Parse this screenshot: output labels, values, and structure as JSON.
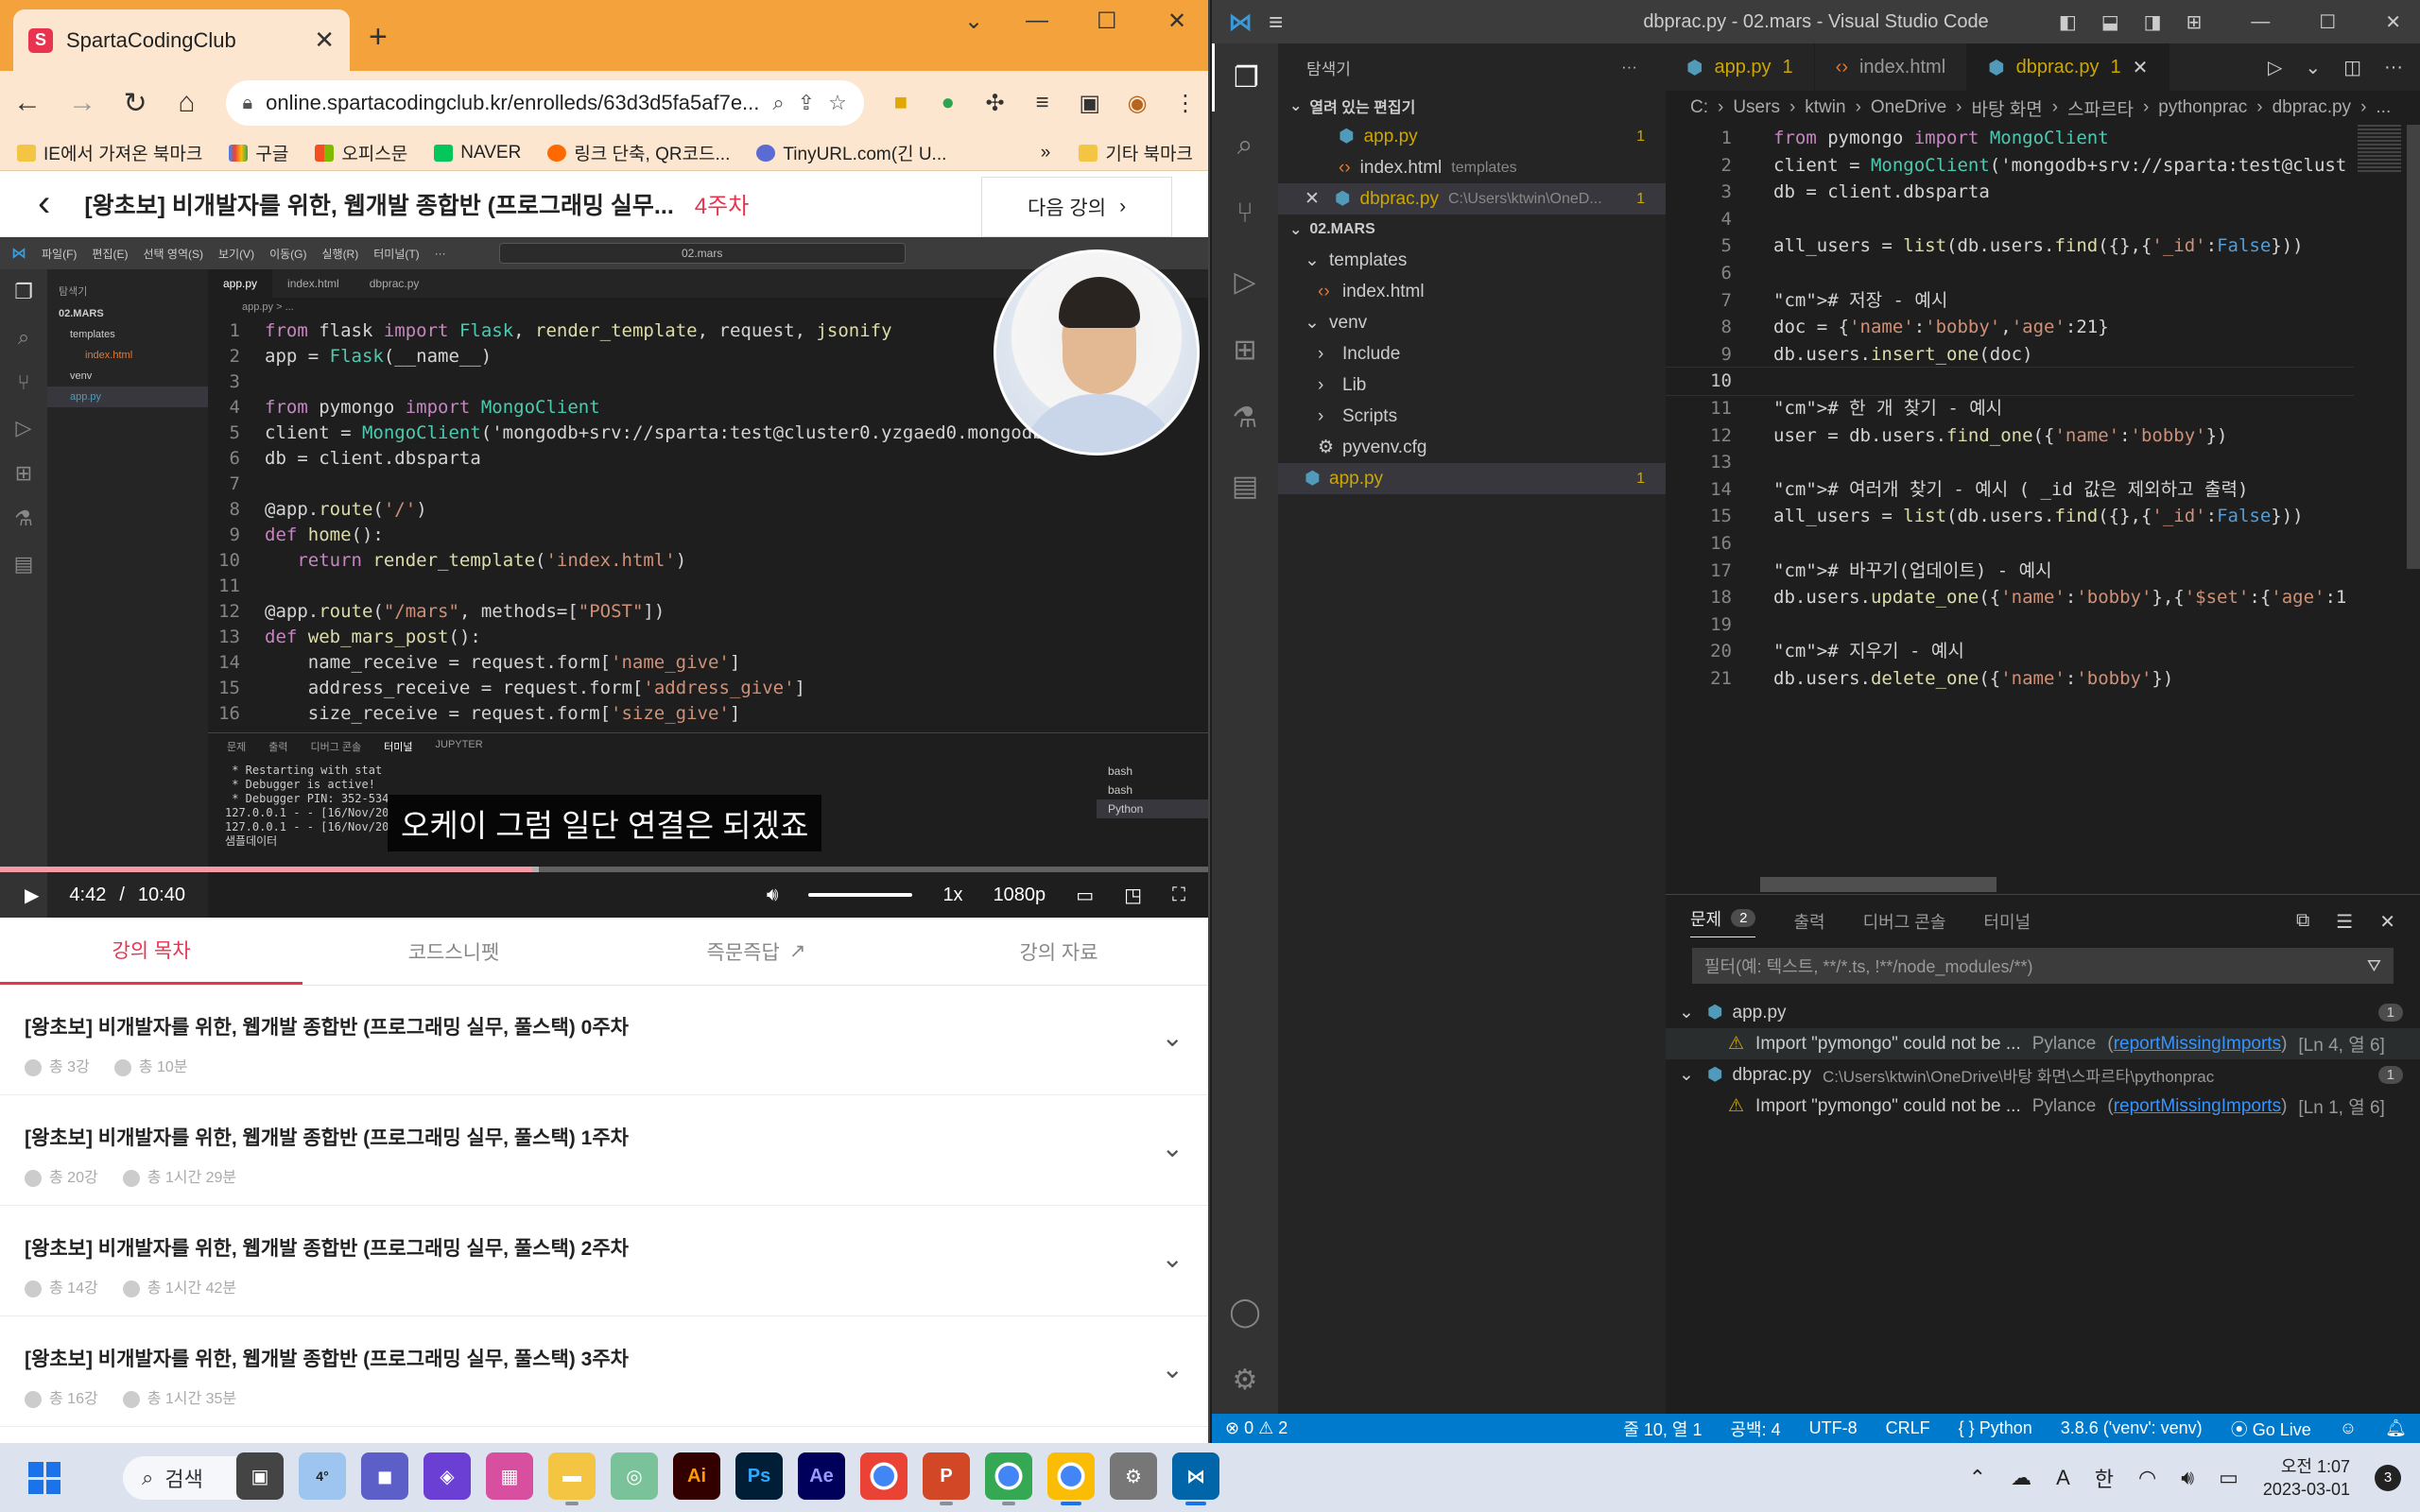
{
  "chrome": {
    "tab_title": "SpartaCodingClub",
    "tab_favicon": "S",
    "new_tab": "+",
    "window_controls": [
      "—",
      "☐",
      "✕"
    ],
    "url": "online.spartacodingclub.kr/enrolleds/63d3d5fa5af7e...",
    "bookmarks": [
      "IE에서 가져온 북마크",
      "구글",
      "오피스문",
      "NAVER",
      "링크 단축, QR코드...",
      "TinyURL.com(긴 U..."
    ],
    "bookmarks_more": "»",
    "bookmarks_other": "기타 북마크"
  },
  "page": {
    "title": "[왕초보] 비개발자를 위한, 웹개발 종합반 (프로그래밍 실무...",
    "week": "4주차",
    "next_label": "다음 강의"
  },
  "video": {
    "subtitle": "오케이 그럼 일단 연결은 되겠죠",
    "current_time": "4:42",
    "separator": "/",
    "duration": "10:40",
    "progress_fraction": 0.44,
    "speed": "1x",
    "quality": "1080p",
    "inner_vscode": {
      "search": "02.mars",
      "explorer_title": "탐색기",
      "tree": [
        "02.MARS",
        "templates",
        "index.html",
        "venv",
        "app.py"
      ],
      "tabs": [
        "app.py",
        "index.html",
        "dbprac.py"
      ],
      "breadcrumb": "app.py > ...",
      "code": [
        "from flask import Flask, render_template, request, jsonify",
        "app = Flask(__name__)",
        "",
        "from pymongo import MongoClient",
        "client = MongoClient('mongodb+srv://sparta:test@cluster0.yzgaed0.mongodb.",
        "db = client.dbsparta",
        "",
        "@app.route('/')",
        "def home():",
        "   return render_template('index.html')",
        "",
        "@app.route(\"/mars\", methods=[\"POST\"])",
        "def web_mars_post():",
        "    name_receive = request.form['name_give']",
        "    address_receive = request.form['address_give']",
        "    size_receive = request.form['size_give']"
      ],
      "terminal_tabs": [
        "문제",
        "출력",
        "디버그 콘솔",
        "터미널",
        "JUPYTER"
      ],
      "terminal_lines": " * Restarting with stat\n * Debugger is active!\n * Debugger PIN: 352-534\n127.0.0.1 - - [16/Nov/20\n127.0.0.1 - - [16/Nov/20\n샘플데이터",
      "terminal_sessions": [
        "bash",
        "bash",
        "Python"
      ]
    }
  },
  "lecture_tabs": [
    {
      "label": "강의 목차",
      "active": true
    },
    {
      "label": "코드스니펫",
      "active": false
    },
    {
      "label": "즉문즉답",
      "active": false
    },
    {
      "label": "강의 자료",
      "active": false
    }
  ],
  "weeks": [
    {
      "title": "[왕초보] 비개발자를 위한, 웹개발 종합반 (프로그래밍 실무, 풀스택) 0주차",
      "lectures": "총 3강",
      "time": "총 10분"
    },
    {
      "title": "[왕초보] 비개발자를 위한, 웹개발 종합반 (프로그래밍 실무, 풀스택) 1주차",
      "lectures": "총 20강",
      "time": "총 1시간 29분"
    },
    {
      "title": "[왕초보] 비개발자를 위한, 웹개발 종합반 (프로그래밍 실무, 풀스택) 2주차",
      "lectures": "총 14강",
      "time": "총 1시간 42분"
    },
    {
      "title": "[왕초보] 비개발자를 위한, 웹개발 종합반 (프로그래밍 실무, 풀스택) 3주차",
      "lectures": "총 16강",
      "time": "총 1시간 35분"
    }
  ],
  "vscode": {
    "window_title": "dbprac.py - 02.mars - Visual Studio Code",
    "explorer_title": "탐색기",
    "explorer_more": "···",
    "open_editors_label": "열려 있는 편집기",
    "open_editors": [
      {
        "name": "app.py",
        "extra": "",
        "count": "1"
      },
      {
        "name": "index.html",
        "extra": "templates",
        "count": ""
      },
      {
        "name": "dbprac.py",
        "extra": "C:\\Users\\ktwin\\OneD...",
        "count": "1"
      }
    ],
    "folder_label": "02.MARS",
    "tree": [
      {
        "name": "templates",
        "depth": 1,
        "kind": "folder"
      },
      {
        "name": "index.html",
        "depth": 2,
        "kind": "html"
      },
      {
        "name": "venv",
        "depth": 1,
        "kind": "folder"
      },
      {
        "name": "Include",
        "depth": 2,
        "kind": "folder"
      },
      {
        "name": "Lib",
        "depth": 2,
        "kind": "folder"
      },
      {
        "name": "Scripts",
        "depth": 2,
        "kind": "folder"
      },
      {
        "name": "pyvenv.cfg",
        "depth": 2,
        "kind": "cfg"
      },
      {
        "name": "app.py",
        "depth": 1,
        "kind": "py",
        "count": "1"
      }
    ],
    "tabs": [
      {
        "name": "app.py",
        "badge": "1"
      },
      {
        "name": "index.html",
        "badge": ""
      },
      {
        "name": "dbprac.py",
        "badge": "1"
      }
    ],
    "breadcrumb": [
      "C:",
      "Users",
      "ktwin",
      "OneDrive",
      "바탕 화면",
      "스파르타",
      "pythonprac",
      "dbprac.py",
      "..."
    ],
    "code": [
      "from pymongo import MongoClient",
      "client = MongoClient('mongodb+srv://sparta:test@clust",
      "db = client.dbsparta",
      "",
      "all_users = list(db.users.find({},{'_id':False}))",
      "",
      "# 저장 - 예시",
      "doc = {'name':'bobby','age':21}",
      "db.users.insert_one(doc)",
      "",
      "# 한 개 찾기 - 예시",
      "user = db.users.find_one({'name':'bobby'})",
      "",
      "# 여러개 찾기 - 예시 ( _id 값은 제외하고 출력)",
      "all_users = list(db.users.find({},{'_id':False}))",
      "",
      "# 바꾸기(업데이트) - 예시",
      "db.users.update_one({'name':'bobby'},{'$set':{'age':1",
      "",
      "# 지우기 - 예시",
      "db.users.delete_one({'name':'bobby'})"
    ],
    "current_line": 10,
    "panel_tabs": [
      "문제",
      "출력",
      "디버그 콘솔",
      "터미널"
    ],
    "problems_count": "2",
    "filter_placeholder": "필터(예: 텍스트, **/*.ts, !**/node_modules/**)",
    "problems": [
      {
        "file": "app.py",
        "path": "",
        "count": "1",
        "message": "Import \"pymongo\" could not be ...",
        "source": "Pylance",
        "rule": "reportMissingImports",
        "loc": "[Ln 4, 열 6]"
      },
      {
        "file": "dbprac.py",
        "path": "C:\\Users\\ktwin\\OneDrive\\바탕 화면\\스파르타\\pythonprac",
        "count": "1",
        "message": "Import \"pymongo\" could not be ...",
        "source": "Pylance",
        "rule": "reportMissingImports",
        "loc": "[Ln 1, 열 6]"
      }
    ],
    "status": {
      "errors": "0",
      "warnings": "2",
      "position": "줄 10, 열 1",
      "spaces": "공백: 4",
      "encoding": "UTF-8",
      "eol": "CRLF",
      "language": "Python",
      "interpreter": "3.8.6 ('venv': venv)",
      "golive": "Go Live"
    }
  },
  "taskbar": {
    "search_label": "검색",
    "weather": "4°",
    "apps": [
      "ai",
      "ps",
      "ae"
    ],
    "app_labels": {
      "ai": "Ai",
      "ps": "Ps",
      "ae": "Ae"
    },
    "ime": "한",
    "ime_mode": "A",
    "time": "오전 1:07",
    "date": "2023-03-01",
    "notifications": "3"
  },
  "colors": {
    "chrome_accent": "#f4a23c",
    "brand_red": "#e8344e",
    "vscode_blue": "#007acc",
    "warning": "#cca700"
  }
}
